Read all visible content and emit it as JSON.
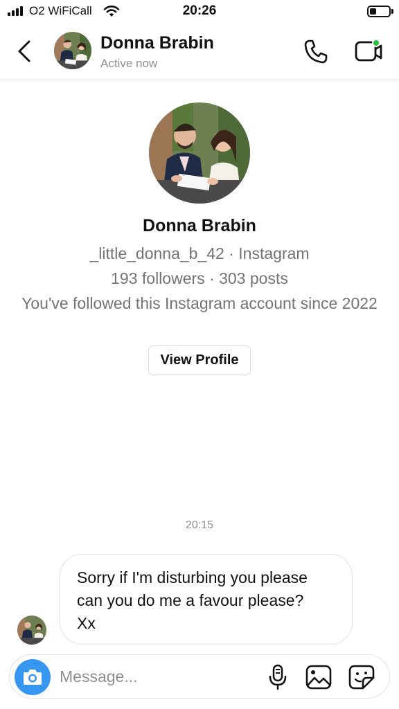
{
  "status_bar": {
    "carrier": "O2 WiFiCall",
    "time": "20:26",
    "signal_bars": 4,
    "battery_level": 0.35
  },
  "header": {
    "contact_name": "Donna Brabin",
    "status": "Active now",
    "online": true
  },
  "profile": {
    "name": "Donna Brabin",
    "handle_line": "_little_donna_b_42 · Instagram",
    "stats_line": "193 followers · 303 posts",
    "since_line": "You've followed this Instagram account since 2022",
    "view_profile_label": "View Profile"
  },
  "conversation": {
    "timestamp": "20:15",
    "messages": [
      {
        "from": "contact",
        "lines": [
          "Sorry if I'm disturbing you please",
          "can you do me a favour please?",
          "Xx"
        ]
      }
    ]
  },
  "composer": {
    "placeholder": "Message..."
  },
  "colors": {
    "accent_blue": "#3797f0",
    "online_green": "#1fc23a",
    "muted_text": "#737373"
  },
  "icons": [
    "back-chevron-icon",
    "phone-icon",
    "video-camera-icon",
    "camera-icon",
    "microphone-icon",
    "gallery-icon",
    "sticker-icon"
  ]
}
